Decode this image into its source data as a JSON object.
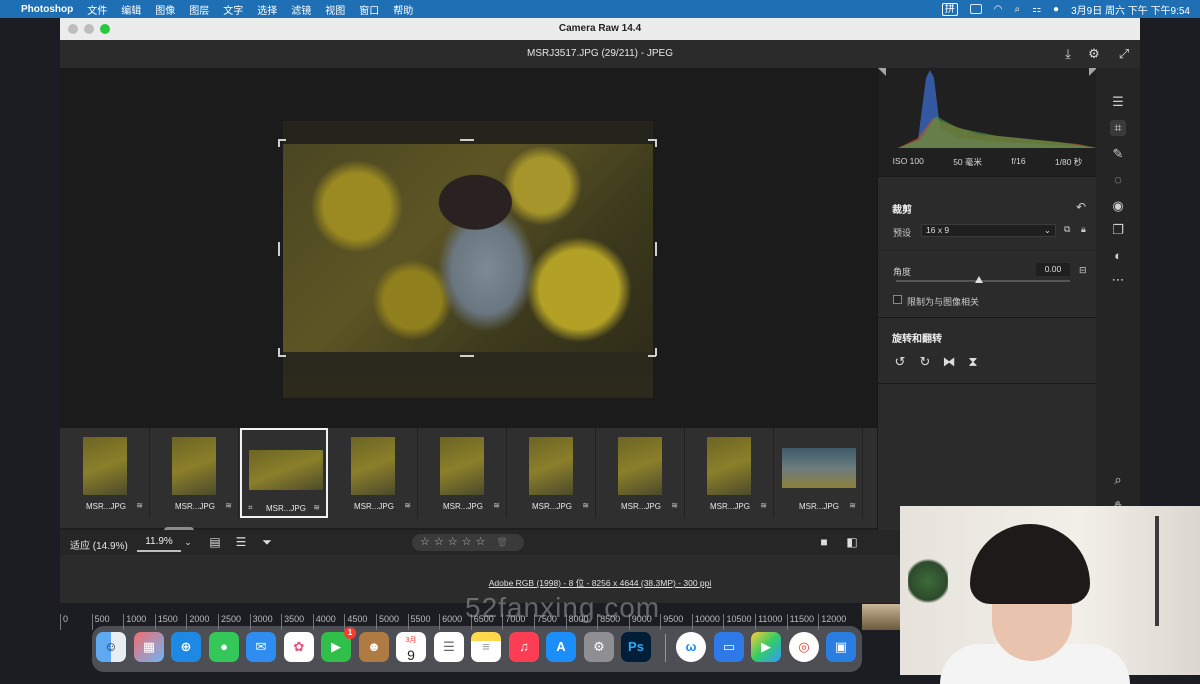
{
  "menubar": {
    "apple": "",
    "app_name": "Photoshop",
    "items": [
      "文件",
      "编辑",
      "图像",
      "图层",
      "文字",
      "选择",
      "滤镜",
      "视图",
      "窗口",
      "帮助"
    ],
    "input_method": "拼",
    "clock": "3月9日 周六 下午 下午9:54"
  },
  "window": {
    "title": "Camera Raw 14.4",
    "file_header": "MSRJ3517.JPG (29/211) -  JPEG"
  },
  "histogram": {
    "exif": {
      "iso": "ISO 100",
      "focal": "50 毫米",
      "aperture": "f/16",
      "shutter": "1/80 秒"
    }
  },
  "crop_panel": {
    "title": "裁剪",
    "preset_label": "预设",
    "preset_value": "16 x 9",
    "angle_label": "角度",
    "angle_value": "0.00",
    "constrain_label": "限制为与图像相关",
    "rotate_title": "旋转和翻转"
  },
  "filmstrip": {
    "items": [
      {
        "name": "MSR...JPG",
        "selected": false,
        "crop_badge": false,
        "kind": "portrait"
      },
      {
        "name": "MSR...JPG",
        "selected": false,
        "crop_badge": false,
        "kind": "portrait"
      },
      {
        "name": "MSR...JPG",
        "selected": true,
        "crop_badge": true,
        "kind": "landscape"
      },
      {
        "name": "MSR...JPG",
        "selected": false,
        "crop_badge": false,
        "kind": "portrait"
      },
      {
        "name": "MSR...JPG",
        "selected": false,
        "crop_badge": false,
        "kind": "portrait"
      },
      {
        "name": "MSR...JPG",
        "selected": false,
        "crop_badge": false,
        "kind": "portrait"
      },
      {
        "name": "MSR...JPG",
        "selected": false,
        "crop_badge": false,
        "kind": "portrait"
      },
      {
        "name": "MSR...JPG",
        "selected": false,
        "crop_badge": false,
        "kind": "portrait"
      },
      {
        "name": "MSR...JPG",
        "selected": false,
        "crop_badge": false,
        "kind": "landscape-blue"
      }
    ]
  },
  "toolbar": {
    "zoom_fit": "适应 (14.9%)",
    "zoom_value": "11.9%",
    "rating": "☆☆☆☆☆"
  },
  "footer": {
    "info": "Adobe RGB (1998) - 8 位 - 8256 x 4644 (38.3MP) - 300 ppi"
  },
  "ruler": [
    "0",
    "500",
    "1000",
    "1500",
    "2000",
    "2500",
    "3000",
    "3500",
    "4000",
    "4500",
    "5000",
    "5500",
    "6000",
    "6500",
    "7000",
    "7500",
    "8000",
    "8500",
    "9000",
    "9500",
    "10000",
    "10500",
    "11000",
    "11500",
    "12000"
  ],
  "watermark": "52fanxing.com",
  "dock": {
    "calendar_month": "3月",
    "calendar_day": "9",
    "facetime_badge": "1",
    "photoshop_label": "Ps"
  },
  "colors": {
    "menubar": "#1f6fb5",
    "panel": "#2b2b2b",
    "canvas": "#1b1b1b",
    "filmstrip": "#2f2f2f"
  }
}
